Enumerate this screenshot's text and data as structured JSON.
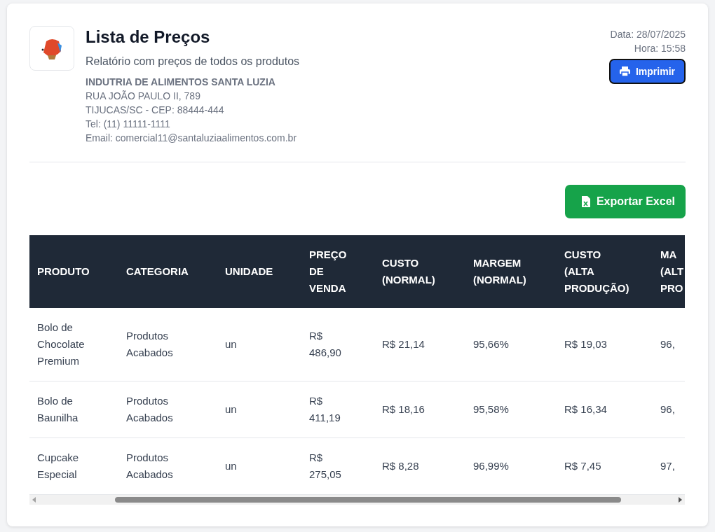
{
  "header": {
    "title": "Lista de Preços",
    "subtitle": "Relatório com preços de todos os produtos",
    "company": [
      "INDUTRIA DE ALIMENTOS SANTA LUZIA",
      "RUA JOÃO PAULO II, 789",
      "TIJUCAS/SC - CEP: 88444-444",
      "Tel: (11) 11111-1111",
      "Email: comercial11@santaluziaalimentos.com.br"
    ],
    "date": "Data: 28/07/2025",
    "time": "Hora: 15:58",
    "print_button": "Imprimir"
  },
  "export_button": "Exportar Excel",
  "table": {
    "columns": [
      "PRODUTO",
      "CATEGORIA",
      "UNIDADE",
      "PREÇO DE VENDA",
      "CUSTO (NORMAL)",
      "MARGEM (NORMAL)",
      "CUSTO (ALTA PRODUÇÃO)",
      "MA (ALT PRO"
    ],
    "rows": [
      [
        "Bolo de Chocolate Premium",
        "Produtos Acabados",
        "un",
        "R$ 486,90",
        "R$ 21,14",
        "95,66%",
        "R$ 19,03",
        "96,"
      ],
      [
        "Bolo de Baunilha",
        "Produtos Acabados",
        "un",
        "R$ 411,19",
        "R$ 18,16",
        "95,58%",
        "R$ 16,34",
        "96,"
      ],
      [
        "Cupcake Especial",
        "Produtos Acabados",
        "un",
        "R$ 275,05",
        "R$ 8,28",
        "96,99%",
        "R$ 7,45",
        "97,"
      ]
    ]
  }
}
